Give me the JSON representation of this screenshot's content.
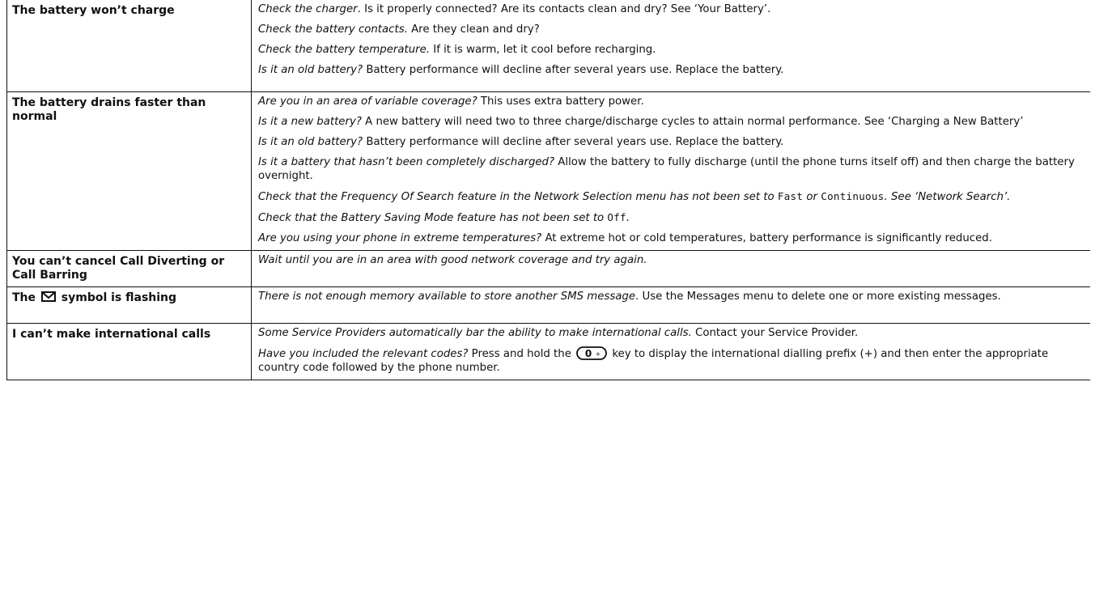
{
  "rows": [
    {
      "problem": "The battery won’t charge",
      "solutions": [
        {
          "it": "Check the charger",
          "rest": ". Is it properly connected? Are its contacts clean and dry? See ‘Your Battery’."
        },
        {
          "it": "Check the battery contacts.",
          "rest": " Are they clean and dry?"
        },
        {
          "it": "Check the battery temperature.",
          "rest": " If it is warm, let it cool before recharging."
        },
        {
          "it": "Is it an old battery?",
          "rest": " Battery performance will decline after several years use. Replace the battery."
        }
      ]
    },
    {
      "problem": "The battery drains faster than normal",
      "solutions": [
        {
          "it": "Are you in an area of variable coverage?",
          "rest": " This uses extra battery power."
        },
        {
          "it": "Is it a new battery?",
          "rest": " A new battery will need two to three charge/discharge cycles to attain normal performance. See ‘Charging a New Battery’"
        },
        {
          "it": "Is it an old battery?",
          "rest": " Battery performance will decline after several years use. Replace the battery."
        },
        {
          "it": "Is it a battery that hasn’t been completely discharged?",
          "rest": " Allow the battery to fully discharge (until the phone turns itself off) and then charge the battery overnight."
        },
        {
          "frequency": {
            "a": "Check that the Frequency Of Search feature in the Network Selection menu has not been set to ",
            "lcd1": "Fast",
            "b": " or ",
            "lcd2": "Continuous",
            "c": ". See ‘Network Search’."
          }
        },
        {
          "saving": {
            "a": "Check that the Battery Saving Mode feature has not been set to ",
            "lcd": "Off",
            "b": "."
          }
        },
        {
          "it": "Are you using your phone in extreme temperatures?",
          "rest": " At extreme hot or cold temperatures, battery performance is significantly reduced."
        }
      ]
    },
    {
      "problem": "You can’t cancel Call Diverting or Call Barring",
      "solutions": [
        {
          "it": "Wait until you are in an area with good network coverage and try again."
        }
      ]
    },
    {
      "problem_a": "The",
      "problem_b": "symbol is flashing",
      "icon": "envelope-icon",
      "solutions": [
        {
          "it": "There is not enough memory available to store another SMS message",
          "rest": ". Use the Messages menu to delete one or more existing messages."
        }
      ]
    },
    {
      "problem": "I can’t make international calls",
      "solutions": [
        {
          "it": "Some Service Providers automatically bar the ability to make international calls.",
          "rest": " Contact your Service Provider."
        },
        {
          "codes": {
            "it": "Have you included the relevant codes?",
            "a": " Press and hold the ",
            "key_label": "0",
            "key_icon": "zero-key-icon",
            "b": " key to display the international dialling prefix (+) and then enter the appropriate country code followed by the phone number."
          }
        }
      ]
    }
  ]
}
